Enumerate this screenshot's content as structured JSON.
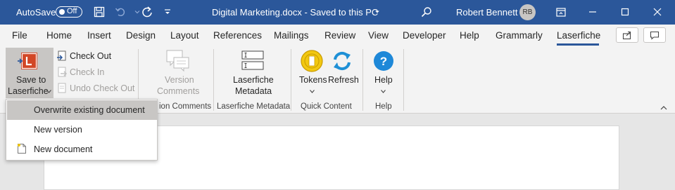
{
  "titlebar": {
    "autosave_label": "AutoSave",
    "autosave_state": "Off",
    "doc_title": "Digital Marketing.docx  -  Saved to this PC",
    "user_name": "Robert Bennett",
    "user_initials": "RB",
    "bg_color": "#2b579a"
  },
  "tabs": [
    "File",
    "Home",
    "Insert",
    "Design",
    "Layout",
    "References",
    "Mailings",
    "Review",
    "View",
    "Developer",
    "Help",
    "Grammarly",
    "Laserfiche"
  ],
  "active_tab": "Laserfiche",
  "ribbon": {
    "save_to": "Save to",
    "laserfiche": "Laserfiche",
    "check_out": "Check Out",
    "check_in": "Check In",
    "undo_check_out": "Undo Check Out",
    "version_comments_l1": "Version",
    "version_comments_l2": "Comments",
    "lf_metadata_l1": "Laserfiche",
    "lf_metadata_l2": "Metadata",
    "tokens": "Tokens",
    "refresh": "Refresh",
    "help": "Help",
    "groups": {
      "version_comments": "ion Comments",
      "lf_metadata": "Laserfiche Metadata",
      "quick_content": "Quick Content",
      "help": "Help"
    }
  },
  "dropdown": {
    "items": [
      "Overwrite existing document",
      "New version",
      "New document"
    ],
    "highlighted_index": 0
  }
}
